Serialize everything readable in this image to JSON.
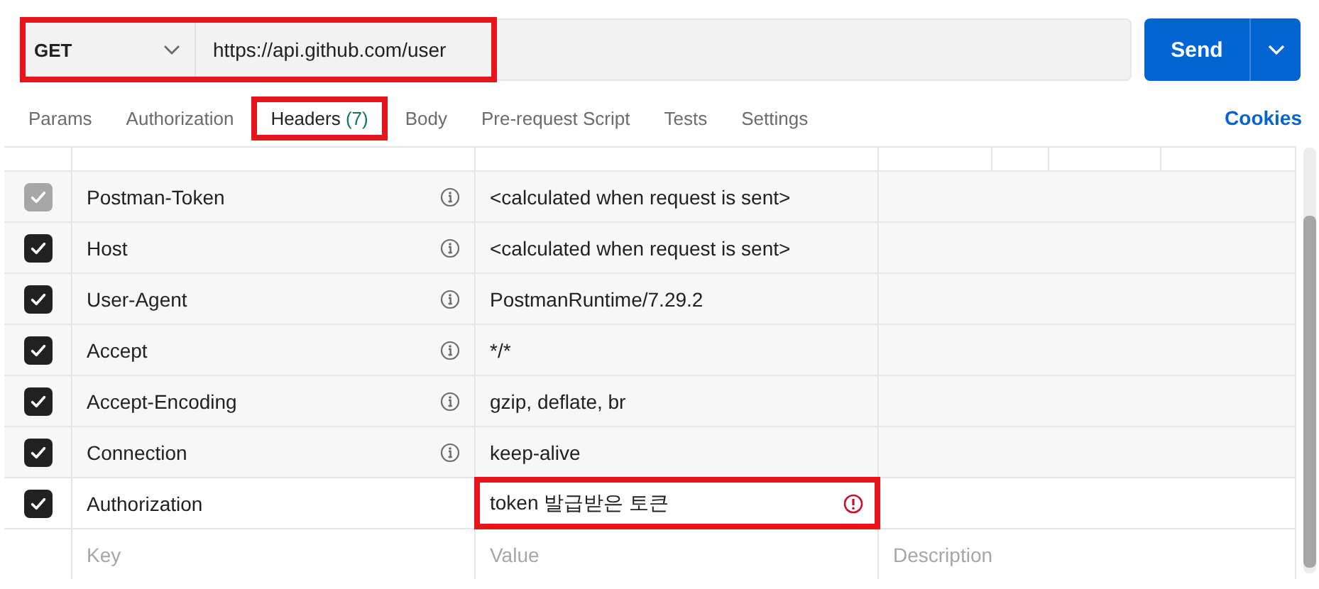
{
  "request": {
    "method": "GET",
    "url": "https://api.github.com/user",
    "highlighted": true,
    "send_label": "Send"
  },
  "tabs": [
    {
      "label": "Params",
      "selected": false,
      "highlighted": false
    },
    {
      "label": "Authorization",
      "selected": false,
      "highlighted": false
    },
    {
      "label": "Headers",
      "count": "(7)",
      "selected": true,
      "highlighted": true
    },
    {
      "label": "Body",
      "selected": false,
      "highlighted": false
    },
    {
      "label": "Pre-request Script",
      "selected": false,
      "highlighted": false
    },
    {
      "label": "Tests",
      "selected": false,
      "highlighted": false
    },
    {
      "label": "Settings",
      "selected": false,
      "highlighted": false
    }
  ],
  "cookies_link": "Cookies",
  "headers": [
    {
      "kind": "auto",
      "checked": true,
      "disabled": true,
      "key": "Postman-Token",
      "value": "<calculated when request is sent>",
      "warning": false,
      "highlighted": false
    },
    {
      "kind": "auto",
      "checked": true,
      "disabled": false,
      "key": "Host",
      "value": "<calculated when request is sent>",
      "warning": false,
      "highlighted": false
    },
    {
      "kind": "auto",
      "checked": true,
      "disabled": false,
      "key": "User-Agent",
      "value": "PostmanRuntime/7.29.2",
      "warning": false,
      "highlighted": false
    },
    {
      "kind": "auto",
      "checked": true,
      "disabled": false,
      "key": "Accept",
      "value": "*/*",
      "warning": false,
      "highlighted": false
    },
    {
      "kind": "auto",
      "checked": true,
      "disabled": false,
      "key": "Accept-Encoding",
      "value": "gzip, deflate, br",
      "warning": false,
      "highlighted": false
    },
    {
      "kind": "auto",
      "checked": true,
      "disabled": false,
      "key": "Connection",
      "value": "keep-alive",
      "warning": false,
      "highlighted": false
    },
    {
      "kind": "custom",
      "checked": true,
      "disabled": false,
      "key": "Authorization",
      "value": "token 발급받은 토큰",
      "warning": true,
      "highlighted": true
    }
  ],
  "new_row": {
    "key_placeholder": "Key",
    "value_placeholder": "Value",
    "description_placeholder": "Description"
  }
}
